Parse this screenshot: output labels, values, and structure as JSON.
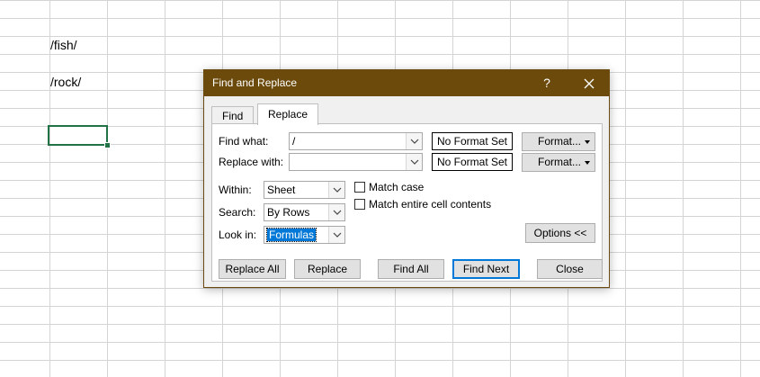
{
  "sheet": {
    "cells": [
      {
        "text": "/fish/"
      },
      {
        "text": "/rock/"
      }
    ],
    "accent": "#217346"
  },
  "dialog": {
    "title": "Find and Replace",
    "help_glyph": "?",
    "close_glyph": "✕",
    "titlebar_color": "#6b4a0b",
    "tabs": [
      {
        "label": "Find",
        "selected": false
      },
      {
        "label": "Replace",
        "selected": true
      }
    ],
    "find_what": {
      "label": "Find what:",
      "value": "/",
      "format_text": "No Format Set",
      "format_button": "Format..."
    },
    "replace_with": {
      "label": "Replace with:",
      "value": "",
      "format_text": "No Format Set",
      "format_button": "Format..."
    },
    "within": {
      "label": "Within:",
      "value": "Sheet"
    },
    "search": {
      "label": "Search:",
      "value": "By Rows"
    },
    "look_in": {
      "label": "Look in:",
      "value": "Formulas"
    },
    "match_case": {
      "label": "Match case",
      "checked": false
    },
    "match_entire": {
      "label": "Match entire cell contents",
      "checked": false
    },
    "options_button": "Options <<",
    "buttons": {
      "replace_all": "Replace All",
      "replace": "Replace",
      "find_all": "Find All",
      "find_next": "Find Next",
      "close": "Close"
    }
  }
}
